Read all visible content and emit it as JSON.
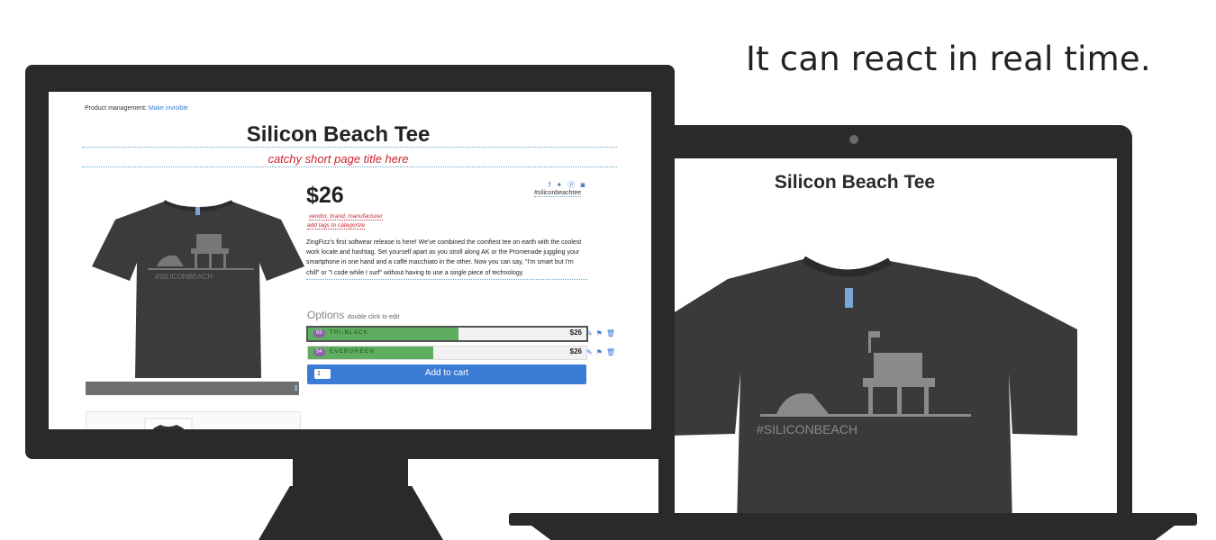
{
  "headline": "It can react in real time.",
  "desktop": {
    "pm_label": "Product management:",
    "pm_link": "Make invisible",
    "product_title": "Silicon Beach Tee",
    "subtitle_placeholder": "catchy short page title here",
    "price": "$26",
    "social_icons": [
      "facebook-icon",
      "twitter-icon",
      "pinterest-icon",
      "instagram-icon"
    ],
    "social_glyphs": "f ✦ ⓟ ◙",
    "hashtag": "#siliconbeachtee",
    "vendor_placeholder": "vendor, brand, manufacturer",
    "tags_placeholder": "add tags to categorize",
    "description": "ZingFizz's first softwear release is here! We've combined the comfiest tee on earth with the coolest work locale and hashtag. Set yourself apart as you stroll along AK or the Promenade juggling your smartphone in one hand and a caffé macchiato in the other. Now you can say, \"I'm smart but I'm chill\" or \"I code while I surf\" without having to use a single piece of technology.",
    "options_title": "Options",
    "options_hint": "double click to edit",
    "options": [
      {
        "count": "65",
        "name": "TRI-BLACK",
        "price": "$26",
        "stock_fill": 0.54
      },
      {
        "count": "54",
        "name": "EVERGREEN",
        "price": "$26",
        "stock_fill": 0.45
      }
    ],
    "cart_qty": "1",
    "cart_label": "Add to cart",
    "shirt_print": "#SILICONBEACH"
  },
  "laptop": {
    "product_title": "Silicon Beach Tee",
    "shirt_print": "#SILICONBEACH"
  }
}
